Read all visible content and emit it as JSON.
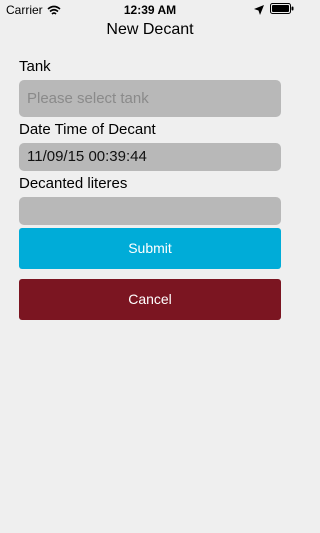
{
  "status_bar": {
    "carrier": "Carrier",
    "time": "12:39 AM"
  },
  "nav": {
    "title": "New Decant"
  },
  "form": {
    "tank": {
      "label": "Tank",
      "placeholder": "Please select tank",
      "value": ""
    },
    "datetime": {
      "label": "Date Time of Decant",
      "value": "11/09/15 00:39:44"
    },
    "liters": {
      "label": "Decanted literes",
      "value": ""
    }
  },
  "buttons": {
    "submit_label": "Submit",
    "cancel_label": "Cancel"
  },
  "colors": {
    "submit": "#00acd8",
    "cancel": "#7b1521",
    "field_bg": "#b8b8b8",
    "page_bg": "#efefef"
  }
}
